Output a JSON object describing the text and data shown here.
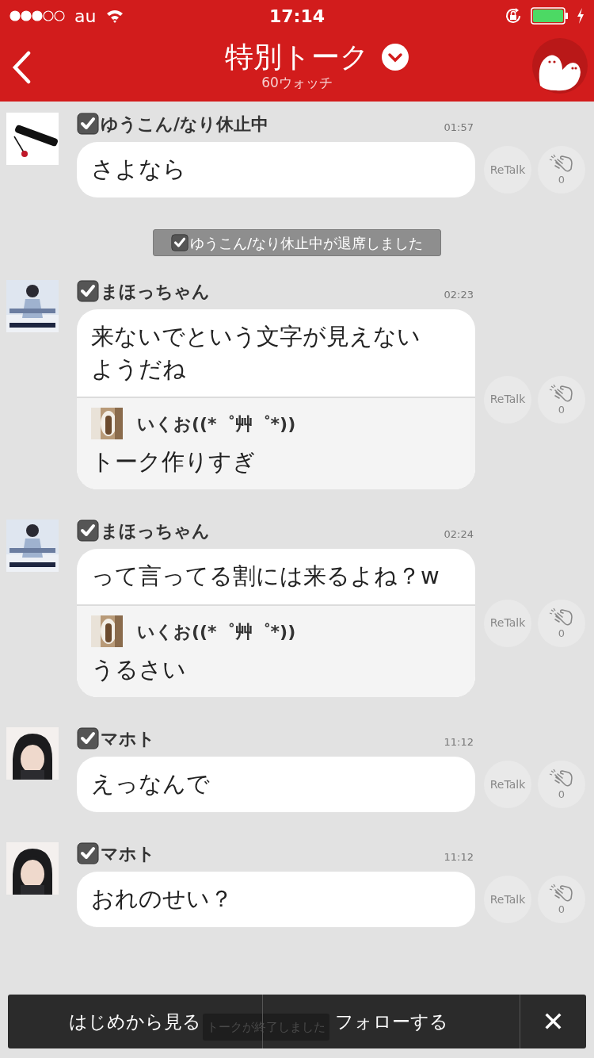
{
  "status_bar": {
    "carrier": "au",
    "time": "17:14"
  },
  "header": {
    "title": "特別トーク",
    "subtitle": "60ウォッチ"
  },
  "messages": [
    {
      "kind": "message",
      "name": "ゆうこん/なり休止中",
      "time": "01:57",
      "text": "さよなら",
      "retalk": "ReTalk",
      "claps": "0"
    },
    {
      "kind": "system",
      "text": "ゆうこん/なり休止中が退席しました"
    },
    {
      "kind": "message",
      "name": "まほっちゃん",
      "time": "02:23",
      "text": "来ないでという文字が見えないようだね",
      "quote": {
        "name": "いくお((*゜艸゜*))",
        "text": "トーク作りすぎ"
      },
      "retalk": "ReTalk",
      "claps": "0"
    },
    {
      "kind": "message",
      "name": "まほっちゃん",
      "time": "02:24",
      "text": "って言ってる割には来るよね？w",
      "quote": {
        "name": "いくお((*゜艸゜*))",
        "text": "うるさい"
      },
      "retalk": "ReTalk",
      "claps": "0"
    },
    {
      "kind": "message",
      "name": "マホト",
      "time": "11:12",
      "text": "えっなんで",
      "retalk": "ReTalk",
      "claps": "0"
    },
    {
      "kind": "message",
      "name": "マホト",
      "time": "11:12",
      "text": "おれのせい？",
      "retalk": "ReTalk",
      "claps": "0"
    }
  ],
  "toast": "トークが終了しました",
  "bottom_bar": {
    "buttons": [
      "はじめから見る",
      "フォローする"
    ],
    "close": "✕"
  }
}
